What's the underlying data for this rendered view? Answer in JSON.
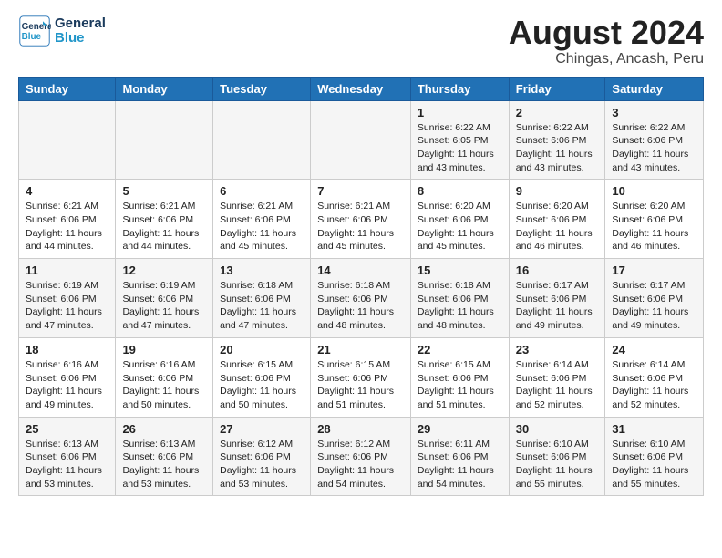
{
  "header": {
    "logo_line1": "General",
    "logo_line2": "Blue",
    "title": "August 2024",
    "subtitle": "Chingas, Ancash, Peru"
  },
  "weekdays": [
    "Sunday",
    "Monday",
    "Tuesday",
    "Wednesday",
    "Thursday",
    "Friday",
    "Saturday"
  ],
  "weeks": [
    [
      {
        "day": "",
        "sunrise": "",
        "sunset": "",
        "daylight": ""
      },
      {
        "day": "",
        "sunrise": "",
        "sunset": "",
        "daylight": ""
      },
      {
        "day": "",
        "sunrise": "",
        "sunset": "",
        "daylight": ""
      },
      {
        "day": "",
        "sunrise": "",
        "sunset": "",
        "daylight": ""
      },
      {
        "day": "1",
        "sunrise": "Sunrise: 6:22 AM",
        "sunset": "Sunset: 6:05 PM",
        "daylight": "Daylight: 11 hours and 43 minutes."
      },
      {
        "day": "2",
        "sunrise": "Sunrise: 6:22 AM",
        "sunset": "Sunset: 6:06 PM",
        "daylight": "Daylight: 11 hours and 43 minutes."
      },
      {
        "day": "3",
        "sunrise": "Sunrise: 6:22 AM",
        "sunset": "Sunset: 6:06 PM",
        "daylight": "Daylight: 11 hours and 43 minutes."
      }
    ],
    [
      {
        "day": "4",
        "sunrise": "Sunrise: 6:21 AM",
        "sunset": "Sunset: 6:06 PM",
        "daylight": "Daylight: 11 hours and 44 minutes."
      },
      {
        "day": "5",
        "sunrise": "Sunrise: 6:21 AM",
        "sunset": "Sunset: 6:06 PM",
        "daylight": "Daylight: 11 hours and 44 minutes."
      },
      {
        "day": "6",
        "sunrise": "Sunrise: 6:21 AM",
        "sunset": "Sunset: 6:06 PM",
        "daylight": "Daylight: 11 hours and 45 minutes."
      },
      {
        "day": "7",
        "sunrise": "Sunrise: 6:21 AM",
        "sunset": "Sunset: 6:06 PM",
        "daylight": "Daylight: 11 hours and 45 minutes."
      },
      {
        "day": "8",
        "sunrise": "Sunrise: 6:20 AM",
        "sunset": "Sunset: 6:06 PM",
        "daylight": "Daylight: 11 hours and 45 minutes."
      },
      {
        "day": "9",
        "sunrise": "Sunrise: 6:20 AM",
        "sunset": "Sunset: 6:06 PM",
        "daylight": "Daylight: 11 hours and 46 minutes."
      },
      {
        "day": "10",
        "sunrise": "Sunrise: 6:20 AM",
        "sunset": "Sunset: 6:06 PM",
        "daylight": "Daylight: 11 hours and 46 minutes."
      }
    ],
    [
      {
        "day": "11",
        "sunrise": "Sunrise: 6:19 AM",
        "sunset": "Sunset: 6:06 PM",
        "daylight": "Daylight: 11 hours and 47 minutes."
      },
      {
        "day": "12",
        "sunrise": "Sunrise: 6:19 AM",
        "sunset": "Sunset: 6:06 PM",
        "daylight": "Daylight: 11 hours and 47 minutes."
      },
      {
        "day": "13",
        "sunrise": "Sunrise: 6:18 AM",
        "sunset": "Sunset: 6:06 PM",
        "daylight": "Daylight: 11 hours and 47 minutes."
      },
      {
        "day": "14",
        "sunrise": "Sunrise: 6:18 AM",
        "sunset": "Sunset: 6:06 PM",
        "daylight": "Daylight: 11 hours and 48 minutes."
      },
      {
        "day": "15",
        "sunrise": "Sunrise: 6:18 AM",
        "sunset": "Sunset: 6:06 PM",
        "daylight": "Daylight: 11 hours and 48 minutes."
      },
      {
        "day": "16",
        "sunrise": "Sunrise: 6:17 AM",
        "sunset": "Sunset: 6:06 PM",
        "daylight": "Daylight: 11 hours and 49 minutes."
      },
      {
        "day": "17",
        "sunrise": "Sunrise: 6:17 AM",
        "sunset": "Sunset: 6:06 PM",
        "daylight": "Daylight: 11 hours and 49 minutes."
      }
    ],
    [
      {
        "day": "18",
        "sunrise": "Sunrise: 6:16 AM",
        "sunset": "Sunset: 6:06 PM",
        "daylight": "Daylight: 11 hours and 49 minutes."
      },
      {
        "day": "19",
        "sunrise": "Sunrise: 6:16 AM",
        "sunset": "Sunset: 6:06 PM",
        "daylight": "Daylight: 11 hours and 50 minutes."
      },
      {
        "day": "20",
        "sunrise": "Sunrise: 6:15 AM",
        "sunset": "Sunset: 6:06 PM",
        "daylight": "Daylight: 11 hours and 50 minutes."
      },
      {
        "day": "21",
        "sunrise": "Sunrise: 6:15 AM",
        "sunset": "Sunset: 6:06 PM",
        "daylight": "Daylight: 11 hours and 51 minutes."
      },
      {
        "day": "22",
        "sunrise": "Sunrise: 6:15 AM",
        "sunset": "Sunset: 6:06 PM",
        "daylight": "Daylight: 11 hours and 51 minutes."
      },
      {
        "day": "23",
        "sunrise": "Sunrise: 6:14 AM",
        "sunset": "Sunset: 6:06 PM",
        "daylight": "Daylight: 11 hours and 52 minutes."
      },
      {
        "day": "24",
        "sunrise": "Sunrise: 6:14 AM",
        "sunset": "Sunset: 6:06 PM",
        "daylight": "Daylight: 11 hours and 52 minutes."
      }
    ],
    [
      {
        "day": "25",
        "sunrise": "Sunrise: 6:13 AM",
        "sunset": "Sunset: 6:06 PM",
        "daylight": "Daylight: 11 hours and 53 minutes."
      },
      {
        "day": "26",
        "sunrise": "Sunrise: 6:13 AM",
        "sunset": "Sunset: 6:06 PM",
        "daylight": "Daylight: 11 hours and 53 minutes."
      },
      {
        "day": "27",
        "sunrise": "Sunrise: 6:12 AM",
        "sunset": "Sunset: 6:06 PM",
        "daylight": "Daylight: 11 hours and 53 minutes."
      },
      {
        "day": "28",
        "sunrise": "Sunrise: 6:12 AM",
        "sunset": "Sunset: 6:06 PM",
        "daylight": "Daylight: 11 hours and 54 minutes."
      },
      {
        "day": "29",
        "sunrise": "Sunrise: 6:11 AM",
        "sunset": "Sunset: 6:06 PM",
        "daylight": "Daylight: 11 hours and 54 minutes."
      },
      {
        "day": "30",
        "sunrise": "Sunrise: 6:10 AM",
        "sunset": "Sunset: 6:06 PM",
        "daylight": "Daylight: 11 hours and 55 minutes."
      },
      {
        "day": "31",
        "sunrise": "Sunrise: 6:10 AM",
        "sunset": "Sunset: 6:06 PM",
        "daylight": "Daylight: 11 hours and 55 minutes."
      }
    ]
  ]
}
